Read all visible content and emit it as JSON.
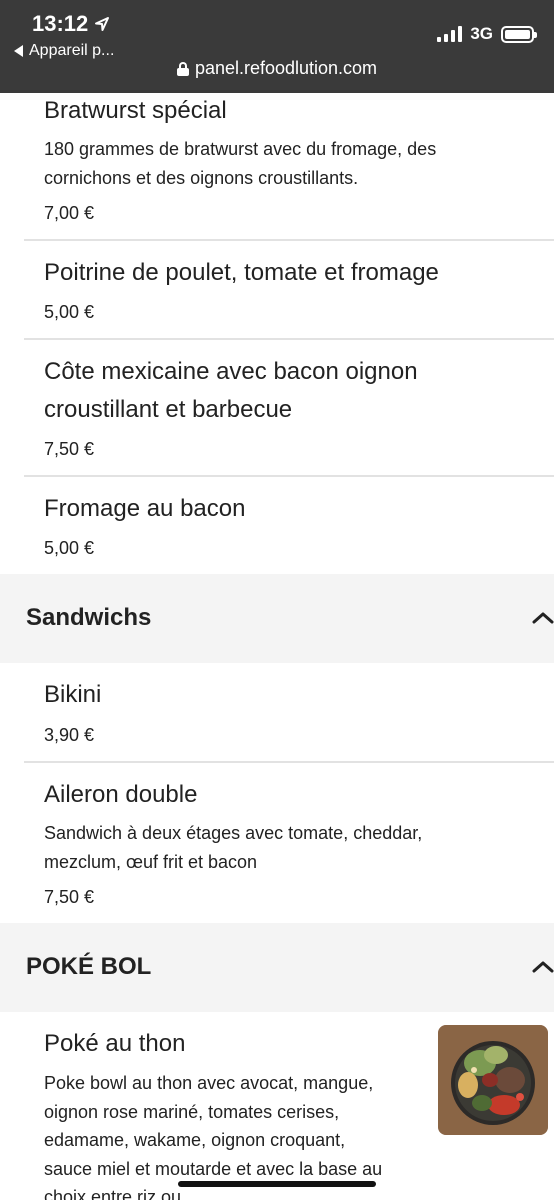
{
  "status_bar": {
    "time": "13:12",
    "back_app": "Appareil p...",
    "network": "3G",
    "url": "panel.refoodlution.com"
  },
  "menu": {
    "items_top": [
      {
        "name": "Bratwurst spécial",
        "description": "180 grammes de bratwurst avec du fromage, des cornichons et des oignons croustillants.",
        "price": "7,00 €"
      },
      {
        "name": "Poitrine de poulet, tomate et fromage",
        "price": "5,00 €"
      },
      {
        "name": "Côte mexicaine avec bacon oignon croustillant et barbecue",
        "price": "7,50 €"
      },
      {
        "name": "Fromage au bacon",
        "price": "5,00 €"
      }
    ],
    "sections": [
      {
        "title": "Sandwichs",
        "items": [
          {
            "name": "Bikini",
            "price": "3,90 €"
          },
          {
            "name": "Aileron double",
            "description": "Sandwich à deux étages avec tomate, cheddar, mezclum, œuf frit et bacon",
            "price": "7,50 €"
          }
        ]
      },
      {
        "title": "POKÉ BOL",
        "items": [
          {
            "name": "Poké au thon",
            "description": "Poke bowl au thon avec avocat, mangue, oignon rose mariné, tomates cerises, edamame, wakame, oignon croquant, sauce miel et moutarde et avec la base au choix entre riz ou"
          }
        ]
      }
    ]
  },
  "colors": {
    "status_bg": "#3a3a3a",
    "section_bg": "#f4f4f4",
    "divider": "#e2e2e2",
    "text": "#222222"
  },
  "icons": [
    "location-arrow-icon",
    "back-arrow-icon",
    "signal-icon",
    "battery-icon",
    "lock-icon",
    "chevron-up-icon"
  ]
}
